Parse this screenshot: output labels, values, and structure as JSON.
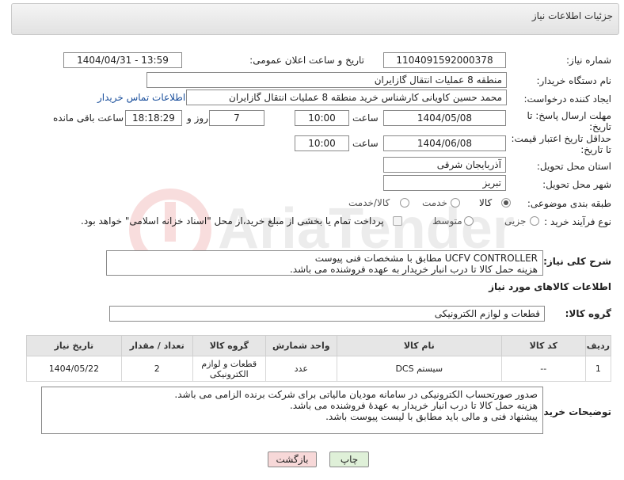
{
  "header": {
    "title": "جزئیات اطلاعات نیاز"
  },
  "fields": {
    "need_number_label": "شماره نیاز:",
    "need_number": "1104091592000378",
    "announce_label": "تاریخ و ساعت اعلان عمومی:",
    "announce_value": "1404/04/31 - 13:59",
    "buyer_org_label": "نام دستگاه خریدار:",
    "buyer_org": "منطقه 8 عملیات انتقال گازایران",
    "requester_label": "ایجاد کننده درخواست:",
    "requester": "محمد حسین کاویانی کارشناس خرید منطقه 8 عملیات انتقال گازایران",
    "contact_link": "اطلاعات تماس خریدار",
    "deadline_label_1": "مهلت ارسال پاسخ: تا",
    "deadline_label_2": "تاریخ:",
    "deadline_date": "1404/05/08",
    "time_label": "ساعت",
    "deadline_time": "10:00",
    "days_value": "7",
    "days_label": "روز و",
    "remaining_time": "18:18:29",
    "remaining_label": "ساعت باقی مانده",
    "validity_label_1": "حداقل تاریخ اعتبار قیمت:",
    "validity_label_2": "تا تاریخ:",
    "validity_date": "1404/06/08",
    "validity_time": "10:00",
    "province_label": "استان محل تحویل:",
    "province": "آذربایجان شرقی",
    "city_label": "شهر محل تحویل:",
    "city": "تبریز",
    "category_label": "طبقه بندی موضوعی:",
    "category_options": [
      "کالا",
      "خدمت",
      "کالا/خدمت"
    ],
    "process_label": "نوع فرآیند خرید :",
    "process_options": [
      "جزیی",
      "متوسط"
    ],
    "payment_note": "پرداخت تمام یا بخشی از مبلغ خرید،از محل \"اسناد خزانه اسلامی\" خواهد بود."
  },
  "description": {
    "label": "شرح کلی نیاز:",
    "line1": "UCFV CONTROLLER مطابق با مشخصات فنی پیوست",
    "line2": "هزینه حمل کالا تا درب انبار خریدار به عهده فروشنده می باشد."
  },
  "goods_section": {
    "title": "اطلاعات کالاهای مورد نیاز",
    "group_label": "گروه کالا:",
    "group_value": "قطعات و لوازم الکترونیکی"
  },
  "table": {
    "headers": [
      "ردیف",
      "کد کالا",
      "نام کالا",
      "واحد شمارش",
      "گروه کالا",
      "تعداد / مقدار",
      "تاریخ نیاز"
    ],
    "rows": [
      [
        "1",
        "--",
        "سیستم DCS",
        "عدد",
        "قطعات و لوازم الکترونیکی",
        "2",
        "1404/05/22"
      ]
    ]
  },
  "buyer_notes": {
    "label": "توضیحات خریدار:",
    "line1": "صدور صورتحساب الکترونیکی در سامانه مودیان مالیاتی برای شرکت برنده الزامی می باشد.",
    "line2": "هزینه حمل کالا تا درب انبار خریدار به عهدهٔ فروشنده می باشد.",
    "line3": "پیشنهاد فنی و مالی باید مطابق با لیست پیوست باشد."
  },
  "buttons": {
    "print": "چاپ",
    "back": "بازگشت"
  },
  "colors": {
    "link": "#1a4f9c",
    "back_button": "#f7d8d8",
    "print_button": "#dff0d8"
  }
}
